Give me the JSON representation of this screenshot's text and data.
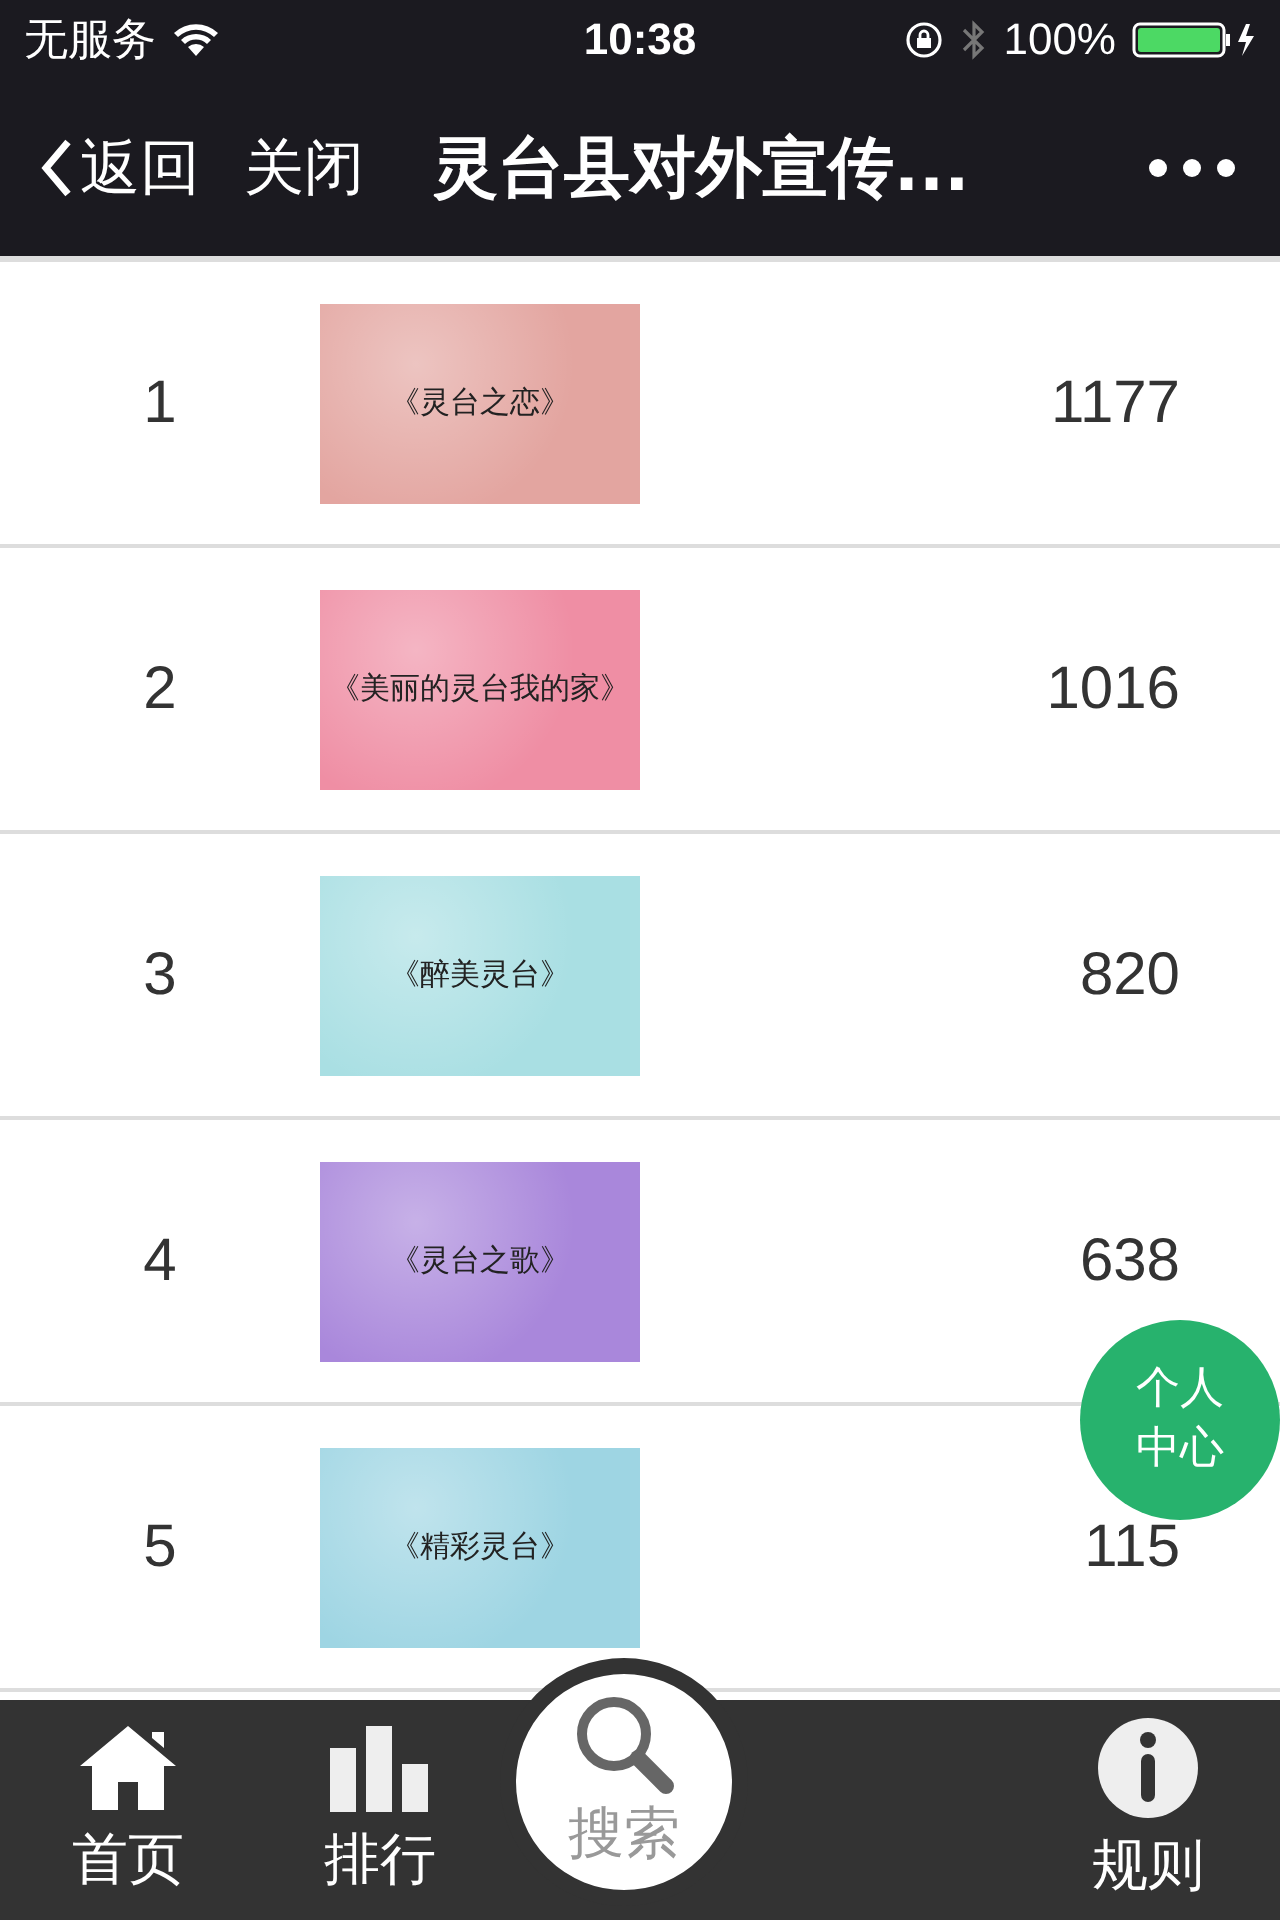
{
  "status_bar": {
    "carrier": "无服务",
    "time": "10:38",
    "battery": "100%"
  },
  "nav": {
    "back": "返回",
    "close": "关闭",
    "title": "灵台县对外宣传..."
  },
  "rows": [
    {
      "rank": "1",
      "title": "《灵台之恋》",
      "count": "1177",
      "color": "#e3a5a0"
    },
    {
      "rank": "2",
      "title": "《美丽的灵台我的家》",
      "count": "1016",
      "color": "#ef8ea4"
    },
    {
      "rank": "3",
      "title": "《醉美灵台》",
      "count": "820",
      "color": "#a9dfe3"
    },
    {
      "rank": "4",
      "title": "《灵台之歌》",
      "count": "638",
      "color": "#a987db"
    },
    {
      "rank": "5",
      "title": "《精彩灵台》",
      "count": "115",
      "color": "#9ed5e3"
    }
  ],
  "float_button": {
    "label": "个人中心"
  },
  "tabs": [
    {
      "label": "首页",
      "kind": "home"
    },
    {
      "label": "排行",
      "kind": "rank"
    },
    {
      "label": "搜索",
      "kind": "search"
    },
    {
      "label": "规则",
      "kind": "info"
    }
  ]
}
